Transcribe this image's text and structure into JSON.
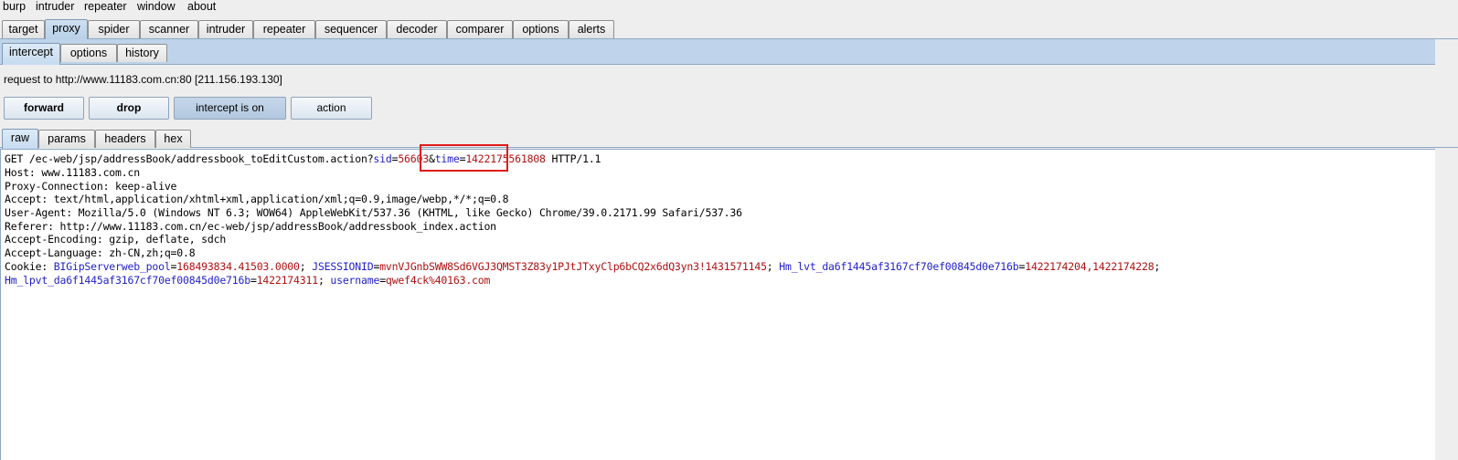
{
  "menu": [
    "burp",
    "intruder",
    "repeater",
    "window",
    "about"
  ],
  "top_tabs": [
    "target",
    "proxy",
    "spider",
    "scanner",
    "intruder",
    "repeater",
    "sequencer",
    "decoder",
    "comparer",
    "options",
    "alerts"
  ],
  "proxy_tabs": [
    "intercept",
    "options",
    "history"
  ],
  "request_line": "request to http://www.11183.com.cn:80  [211.156.193.130]",
  "buttons": {
    "forward": "forward",
    "drop": "drop",
    "intercept": "intercept is on",
    "action": "action"
  },
  "editor_tabs": [
    "raw",
    "params",
    "headers",
    "hex"
  ],
  "request": {
    "get_prefix": "GET /ec-web/jsp/addressBook/addressbook_toEditCustom.action?",
    "sid_key": "sid",
    "eq": "=",
    "sid_val": "56603",
    "amp": "&",
    "time_key": "time",
    "time_val": "1422175561808",
    "get_suffix": " HTTP/1.1",
    "host": "Host: www.11183.com.cn",
    "proxy_conn": "Proxy-Connection: keep-alive",
    "accept": "Accept: text/html,application/xhtml+xml,application/xml;q=0.9,image/webp,*/*;q=0.8",
    "user_agent": "User-Agent: Mozilla/5.0 (Windows NT 6.3; WOW64) AppleWebKit/537.36 (KHTML, like Gecko) Chrome/39.0.2171.99 Safari/537.36",
    "referer": "Referer: http://www.11183.com.cn/ec-web/jsp/addressBook/addressbook_index.action",
    "accept_encoding": "Accept-Encoding: gzip, deflate, sdch",
    "accept_language": "Accept-Language: zh-CN,zh;q=0.8",
    "cookie_label": "Cookie: ",
    "c1_key": "BIGipServerweb_pool",
    "c1_val": "168493834.41503.0000",
    "sep": "; ",
    "c2_key": "JSESSIONID",
    "c2_val": "mvnVJGnbSWW8Sd6VGJ3QMST3Z83y1PJtJTxyClp6bCQ2x6dQ3yn3!1431571145",
    "c3_key": "Hm_lvt_da6f1445af3167cf70ef00845d0e716b",
    "c3_val": "1422174204,1422174228",
    "semi": ";",
    "c4_key": "Hm_lpvt_da6f1445af3167cf70ef00845d0e716b",
    "c4_val": "1422174311",
    "c5_key": "username",
    "c5_val": "qwef4ck%40163.com"
  }
}
